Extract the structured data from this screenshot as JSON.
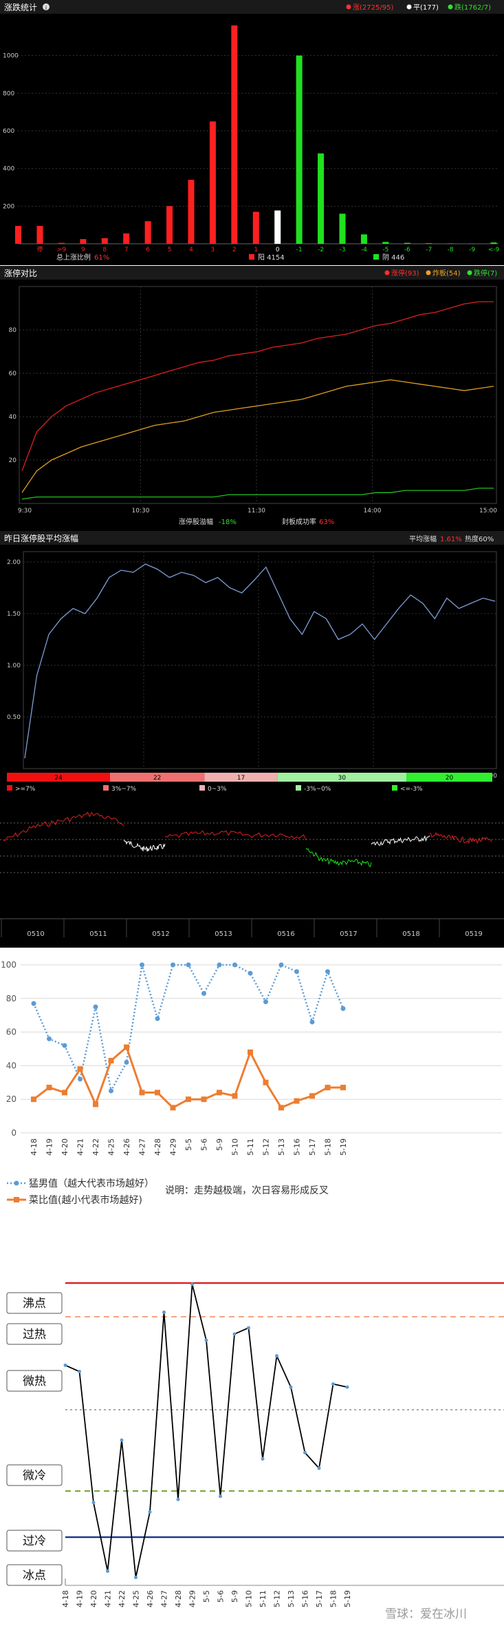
{
  "panel1": {
    "title": "涨跌统计",
    "legend": [
      {
        "label": "涨(2725/95)",
        "color": "#ff3030"
      },
      {
        "label": "平(177)",
        "color": "#ffffff"
      },
      {
        "label": "跌(1762/7)",
        "color": "#30e030"
      }
    ],
    "summary_label": "总上涨比例",
    "summary_value": "61%",
    "yang_label": "阳 4154",
    "yin_label": "阴 446"
  },
  "panel2": {
    "title": "涨停对比",
    "legend": [
      {
        "label": "涨停(93)",
        "color": "#ff3030"
      },
      {
        "label": "炸板(54)",
        "color": "#f0a020"
      },
      {
        "label": "跌停(7)",
        "color": "#30e030"
      }
    ],
    "footer_left_label": "涨停股溢幅",
    "footer_left_value": "-18%",
    "footer_right_label": "封板成功率",
    "footer_right_value": "63%"
  },
  "panel3": {
    "title": "昨日涨停股平均涨幅",
    "right_label": "平均涨幅",
    "right_value": "1.61%",
    "heat_label": "热度60%",
    "dist": [
      {
        "value": "24",
        "color": "#f01010",
        "legend": ">=7%"
      },
      {
        "value": "22",
        "color": "#f07070",
        "legend": "3%~7%"
      },
      {
        "value": "17",
        "color": "#f0b0b0",
        "legend": "0~3%"
      },
      {
        "value": "30",
        "color": "#a0f0a0",
        "legend": "-3%~0%"
      },
      {
        "value": "20",
        "color": "#30f030",
        "legend": "<=-3%"
      }
    ]
  },
  "panel4": {
    "dates": [
      "0510",
      "0511",
      "0512",
      "0513",
      "0516",
      "0517",
      "0518",
      "0519"
    ]
  },
  "panel5": {
    "legend_strong": "猛男值（越大代表市场越好）",
    "legend_weak": "菜比值(越小代表市场越好)",
    "note": "说明：走势越极端，次日容易形成反叉"
  },
  "panel6": {
    "levels": [
      "沸点",
      "过热",
      "微热",
      "微冷",
      "过冷",
      "冰点"
    ],
    "watermark": "雪球：爱在冰川"
  },
  "chart_data": [
    {
      "type": "bar",
      "categories": [
        "停",
        ">9",
        "9",
        "8",
        "7",
        "6",
        "5",
        "4",
        "3",
        "2",
        "1",
        "0",
        "-1",
        "-2",
        "-3",
        "-4",
        "-5",
        "-6",
        "-7",
        "-8",
        "-9",
        "<-9"
      ],
      "values": [
        95,
        5,
        25,
        30,
        55,
        120,
        200,
        340,
        650,
        1160,
        170,
        177,
        1000,
        480,
        160,
        50,
        10,
        5,
        3,
        2,
        1,
        7
      ],
      "first_bar_value": 95,
      "ylim": [
        0,
        1200
      ],
      "y_ticks": [
        200,
        400,
        600,
        800,
        1000
      ],
      "colors": {
        "up": "#ff2020",
        "flat": "#ffffff",
        "down": "#20e020"
      }
    },
    {
      "type": "line",
      "x_ticks": [
        "9:30",
        "10:30",
        "11:30",
        "14:00",
        "15:00"
      ],
      "ylim": [
        0,
        100
      ],
      "y_ticks": [
        20,
        40,
        60,
        80
      ],
      "series": [
        {
          "name": "涨停",
          "color": "#e02020",
          "values": [
            15,
            33,
            40,
            45,
            48,
            51,
            53,
            55,
            57,
            59,
            61,
            63,
            65,
            66,
            68,
            69,
            70,
            72,
            73,
            74,
            76,
            77,
            78,
            80,
            82,
            83,
            85,
            87,
            88,
            90,
            92,
            93,
            93
          ]
        },
        {
          "name": "炸板",
          "color": "#e0a020",
          "values": [
            5,
            15,
            20,
            23,
            26,
            28,
            30,
            32,
            34,
            36,
            37,
            38,
            40,
            42,
            43,
            44,
            45,
            46,
            47,
            48,
            50,
            52,
            54,
            55,
            56,
            57,
            56,
            55,
            54,
            53,
            52,
            53,
            54
          ]
        },
        {
          "name": "跌停",
          "color": "#20c020",
          "values": [
            2,
            3,
            3,
            3,
            3,
            3,
            3,
            3,
            3,
            3,
            3,
            3,
            3,
            3,
            4,
            4,
            4,
            4,
            4,
            4,
            4,
            4,
            4,
            4,
            5,
            5,
            6,
            6,
            6,
            6,
            6,
            7,
            7
          ]
        }
      ]
    },
    {
      "type": "line",
      "x_ticks": [
        "9:30",
        "10:30",
        "11:30",
        "14:00",
        "15:00"
      ],
      "ylim": [
        0,
        2.1
      ],
      "y_ticks": [
        "0.50",
        "1.00",
        "1.50",
        "2.00"
      ],
      "series": [
        {
          "name": "",
          "color": "#7f9fd8",
          "values": [
            0.1,
            0.9,
            1.3,
            1.45,
            1.55,
            1.5,
            1.65,
            1.85,
            1.92,
            1.9,
            1.98,
            1.93,
            1.85,
            1.9,
            1.87,
            1.8,
            1.85,
            1.75,
            1.7,
            1.82,
            1.95,
            1.7,
            1.45,
            1.3,
            1.52,
            1.45,
            1.25,
            1.3,
            1.4,
            1.25,
            1.4,
            1.55,
            1.68,
            1.6,
            1.45,
            1.65,
            1.55,
            1.6,
            1.65,
            1.62
          ]
        }
      ]
    },
    {
      "type": "line",
      "categories": [
        "4-18",
        "4-19",
        "4-20",
        "4-21",
        "4-22",
        "4-25",
        "4-26",
        "4-27",
        "4-28",
        "4-29",
        "5-5",
        "5-6",
        "5-9",
        "5-10",
        "5-11",
        "5-12",
        "5-13",
        "5-16",
        "5-17",
        "5-18",
        "5-19"
      ],
      "ylim": [
        0,
        100
      ],
      "y_ticks": [
        0,
        20,
        40,
        60,
        80,
        100
      ],
      "series": [
        {
          "name": "猛男值（越大代表市场越好）",
          "color": "#5b9bd5",
          "values": [
            77,
            56,
            52,
            32,
            75,
            25,
            42,
            100,
            68,
            100,
            100,
            83,
            100,
            100,
            95,
            78,
            100,
            96,
            66,
            96,
            74
          ]
        },
        {
          "name": "菜比值(越小代表市场越好)",
          "color": "#ed7d31",
          "values": [
            20,
            27,
            24,
            38,
            17,
            43,
            51,
            24,
            24,
            15,
            20,
            20,
            24,
            22,
            48,
            30,
            15,
            19,
            22,
            27,
            27
          ]
        }
      ]
    },
    {
      "type": "line",
      "categories": [
        "4-18",
        "4-19",
        "4-20",
        "4-21",
        "4-22",
        "4-25",
        "4-26",
        "4-27",
        "4-28",
        "4-29",
        "5-5",
        "5-6",
        "5-9",
        "5-10",
        "5-11",
        "5-12",
        "5-13",
        "5-16",
        "5-17",
        "5-18",
        "5-19"
      ],
      "ylim": [
        0,
        100
      ],
      "series": [
        {
          "name": "",
          "color": "#000000",
          "values": [
            69,
            67,
            25,
            3,
            45,
            1,
            22,
            86,
            26,
            95,
            77,
            27,
            79,
            81,
            39,
            72,
            62,
            41,
            36,
            63,
            62
          ]
        }
      ]
    }
  ]
}
